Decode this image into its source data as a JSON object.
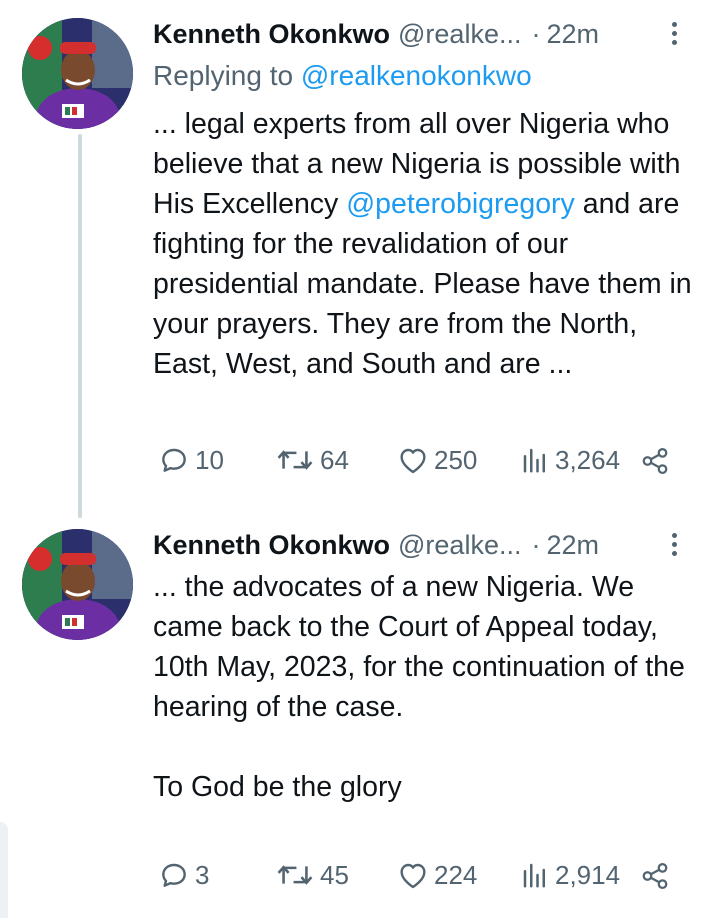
{
  "tweets": [
    {
      "author": {
        "name": "Kenneth Okonkwo",
        "handle": "@realke...",
        "time": "22m"
      },
      "separator": "·",
      "replying_prefix": "Replying to ",
      "replying_to": "@realkenokonkwo",
      "text_before_mention": "... legal experts from all over Nigeria who believe that a new Nigeria is possible with His Excellency",
      "mention": "@peterobigregory",
      "text_after_mention": " and are fighting for the revalidation of our presidential mandate. Please have them in your prayers. They are from the North, East, West, and South and are ...",
      "stats": {
        "replies": "10",
        "reposts": "64",
        "likes": "250",
        "views": "3,264"
      }
    },
    {
      "author": {
        "name": "Kenneth Okonkwo",
        "handle": "@realke...",
        "time": "22m"
      },
      "separator": "·",
      "text": "... the advocates of a new Nigeria. We came back to the Court of Appeal today, 10th May, 2023, for the continuation of the hearing of the case.\n\nTo God be the glory",
      "stats": {
        "replies": "3",
        "reposts": "45",
        "likes": "224",
        "views": "2,914"
      }
    }
  ],
  "icons": [
    "more-options-icon",
    "reply-icon",
    "repost-icon",
    "like-icon",
    "views-icon",
    "share-icon"
  ],
  "colors": {
    "link": "#1d9bf0",
    "secondary_text": "#536471",
    "primary_text": "#0f1419",
    "thread_line": "#cfd9de"
  }
}
